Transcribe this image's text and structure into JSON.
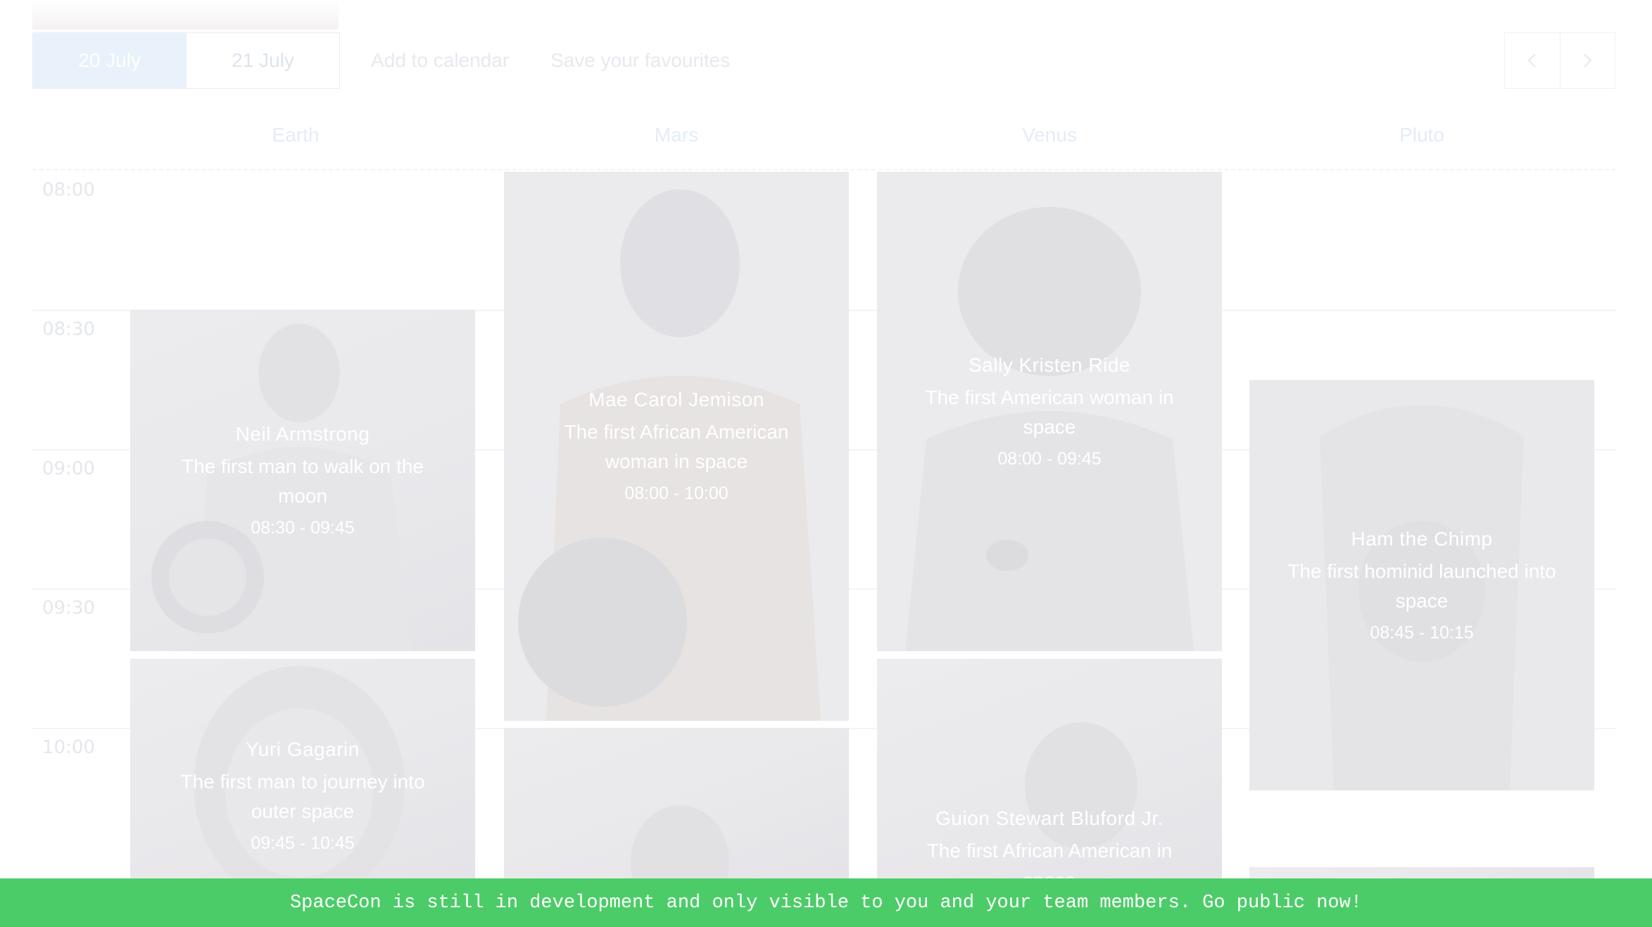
{
  "toolbar": {
    "days": [
      {
        "label": "20 July",
        "active": true
      },
      {
        "label": "21 July",
        "active": false
      }
    ],
    "add_to_calendar": "Add to calendar",
    "save_favourites": "Save your favourites",
    "prev_icon": "chevron-left-icon",
    "next_icon": "chevron-right-icon"
  },
  "columns": [
    "Earth",
    "Mars",
    "Venus",
    "Pluto"
  ],
  "times": [
    "08:00",
    "08:30",
    "09:00",
    "09:30",
    "10:00"
  ],
  "events": [
    {
      "name": "Neil Armstrong",
      "desc": "The first man to walk on the moon",
      "time": "08:30 - 09:45"
    },
    {
      "name": "Yuri Gagarin",
      "desc": "The first man to journey into outer space",
      "time": "09:45 - 10:45"
    },
    {
      "name": "Mae Carol Jemison",
      "desc": "The first African American woman in space",
      "time": "08:00 - 10:00"
    },
    {
      "name": "Sally Kristen Ride",
      "desc": "The first American woman in space",
      "time": "08:00 - 09:45"
    },
    {
      "name": "Guion Stewart Bluford Jr.",
      "desc": "The first African American in space",
      "time": ""
    },
    {
      "name": "Ham the Chimp",
      "desc": "The first hominid launched into space",
      "time": "08:45 - 10:15"
    }
  ],
  "banner": {
    "text": "SpaceCon is still in development and only visible to you and your team members. Go public now!"
  },
  "colors": {
    "banner": "#4ccc68",
    "active_tab": "#e9f1fb"
  }
}
